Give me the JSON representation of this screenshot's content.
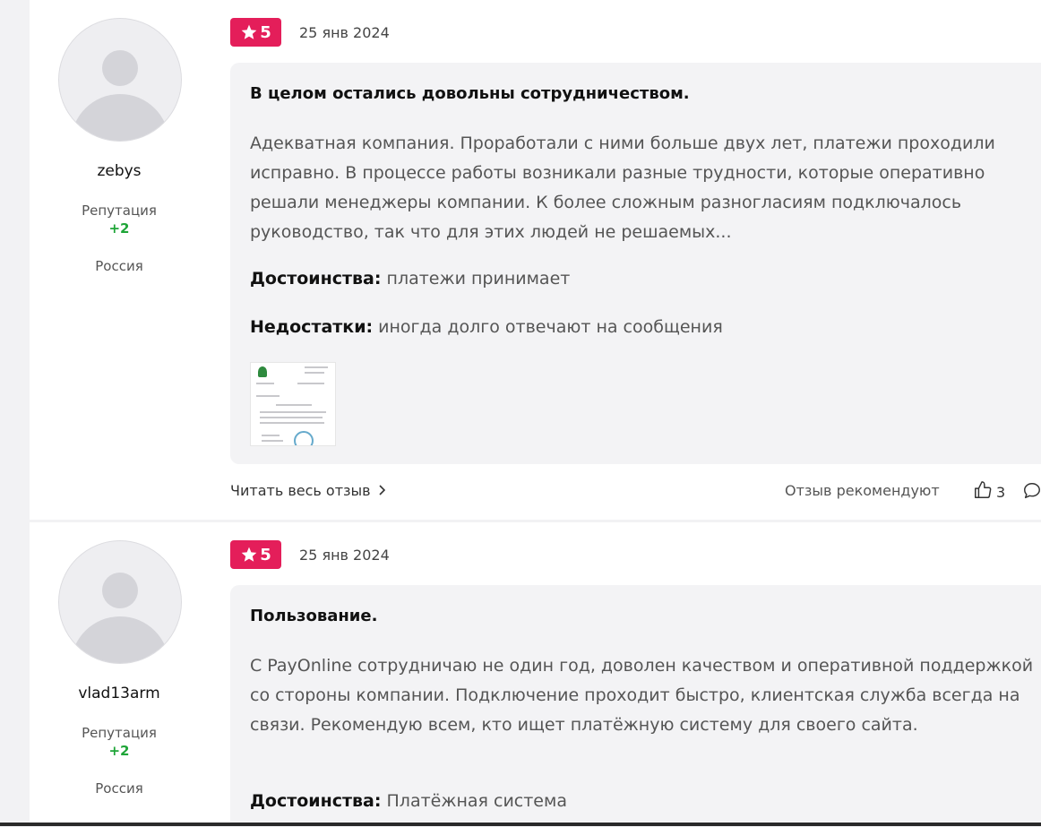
{
  "reviews": [
    {
      "user": {
        "name": "zebys",
        "reputation_label": "Репутация",
        "reputation_value": "+2",
        "country": "Россия"
      },
      "rating": "5",
      "date": "25 янв 2024",
      "title": "В целом остались довольны сотрудничеством.",
      "text": "Адекватная компания. Проработали с ними больше двух лет, платежи проходили исправно. В процессе работы возникали разные трудности, которые оперативно решали менеджеры компании. К более сложным разногласиям подключалось руководство, так что для этих людей не решаемых...",
      "pros_label": "Достоинства:",
      "pros": "платежи принимает",
      "cons_label": "Недостатки:",
      "cons": "иногда долго отвечают на сообщения",
      "read_more": "Читать весь отзыв",
      "recommend_label": "Отзыв рекомендуют",
      "likes": "3"
    },
    {
      "user": {
        "name": "vlad13arm",
        "reputation_label": "Репутация",
        "reputation_value": "+2",
        "country": "Россия"
      },
      "rating": "5",
      "date": "25 янв 2024",
      "title": "Пользование.",
      "text": "С PayOnline сотрудничаю не один год, доволен качеством и оперативной поддержкой со стороны компании. Подключение проходит быстро, клиентская служба всегда на связи. Рекомендую всем, кто ищет платёжную систему для своего сайта.",
      "pros_label": "Достоинства:",
      "pros": "Платёжная система"
    }
  ],
  "colors": {
    "badge": "#e41e5a",
    "reputation": "#1fa538"
  }
}
